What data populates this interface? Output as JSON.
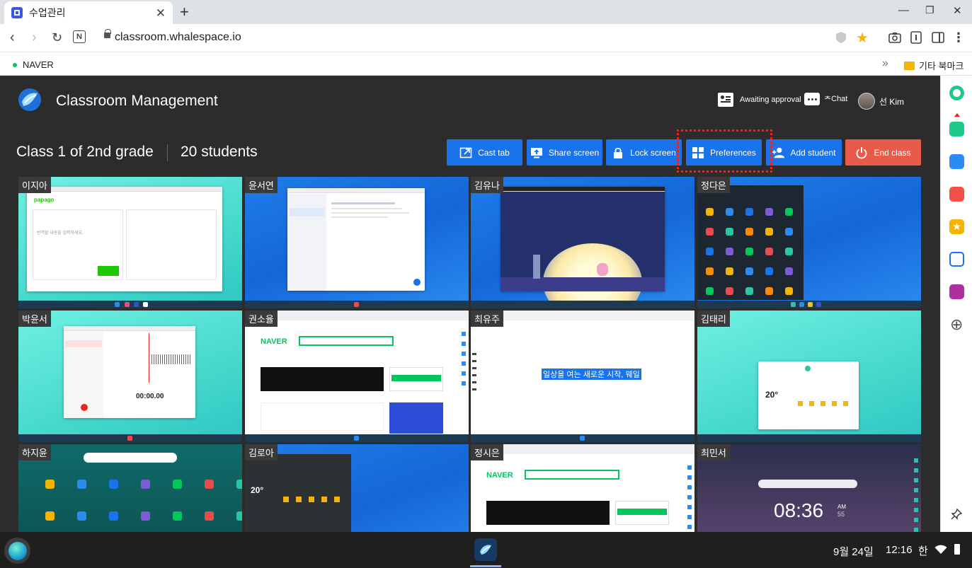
{
  "browser": {
    "tab_title": "수업관리",
    "tab_close": "✕",
    "new_tab": "+",
    "url": "classroom.whalespace.io",
    "bookmarks": {
      "naver": "NAVER",
      "more": "»",
      "other_bookmarks": "기타 북마크"
    }
  },
  "app": {
    "title": "Classroom Management",
    "header": {
      "awaiting_approval": "Awaiting approval",
      "chat": "Chat",
      "chat_prefix": "ᄎ",
      "user_name": "선 Kim"
    },
    "class": {
      "name": "Class 1 of 2nd grade",
      "students": "20 students"
    },
    "buttons": {
      "cast_tab": "Cast tab",
      "share_screen": "Share screen",
      "lock_screen": "Lock screen",
      "preferences": "Preferences",
      "add_student": "Add student",
      "end_class": "End class"
    },
    "colors": {
      "primary": "#1a73e8",
      "danger": "#e85a4a",
      "highlight": "#e8261e",
      "background": "#2c2c2c"
    }
  },
  "students": [
    {
      "name": "이지아",
      "screen": "papago"
    },
    {
      "name": "윤서연",
      "screen": "memo"
    },
    {
      "name": "김유나",
      "screen": "game"
    },
    {
      "name": "정다은",
      "screen": "launcher-grid"
    },
    {
      "name": "박윤서",
      "screen": "recorder",
      "time_display": "00:00.00"
    },
    {
      "name": "권소율",
      "screen": "naver",
      "logo": "NAVER"
    },
    {
      "name": "최유주",
      "screen": "canvas",
      "highlight_text": "일상을 여는 새로운 시작, 웨일"
    },
    {
      "name": "김태리",
      "screen": "weather",
      "temp": "20°"
    },
    {
      "name": "하지윤",
      "screen": "launcher-grid"
    },
    {
      "name": "김로아",
      "screen": "weather",
      "temp": "20°"
    },
    {
      "name": "정시은",
      "screen": "naver",
      "logo": "NAVER"
    },
    {
      "name": "최민서",
      "screen": "lockscreen",
      "clock": "08:36",
      "ampm": "AM",
      "seconds": "55"
    }
  ],
  "taskbar": {
    "date": "9월 24일",
    "time": "12:16",
    "ime": "한"
  },
  "sidebar_icons": [
    "whale-space-icon",
    "notification-icon",
    "calendar-icon",
    "pocket-icon",
    "star-icon",
    "translate-icon",
    "mosaic-app-icon",
    "add-icon",
    "pin-icon"
  ]
}
